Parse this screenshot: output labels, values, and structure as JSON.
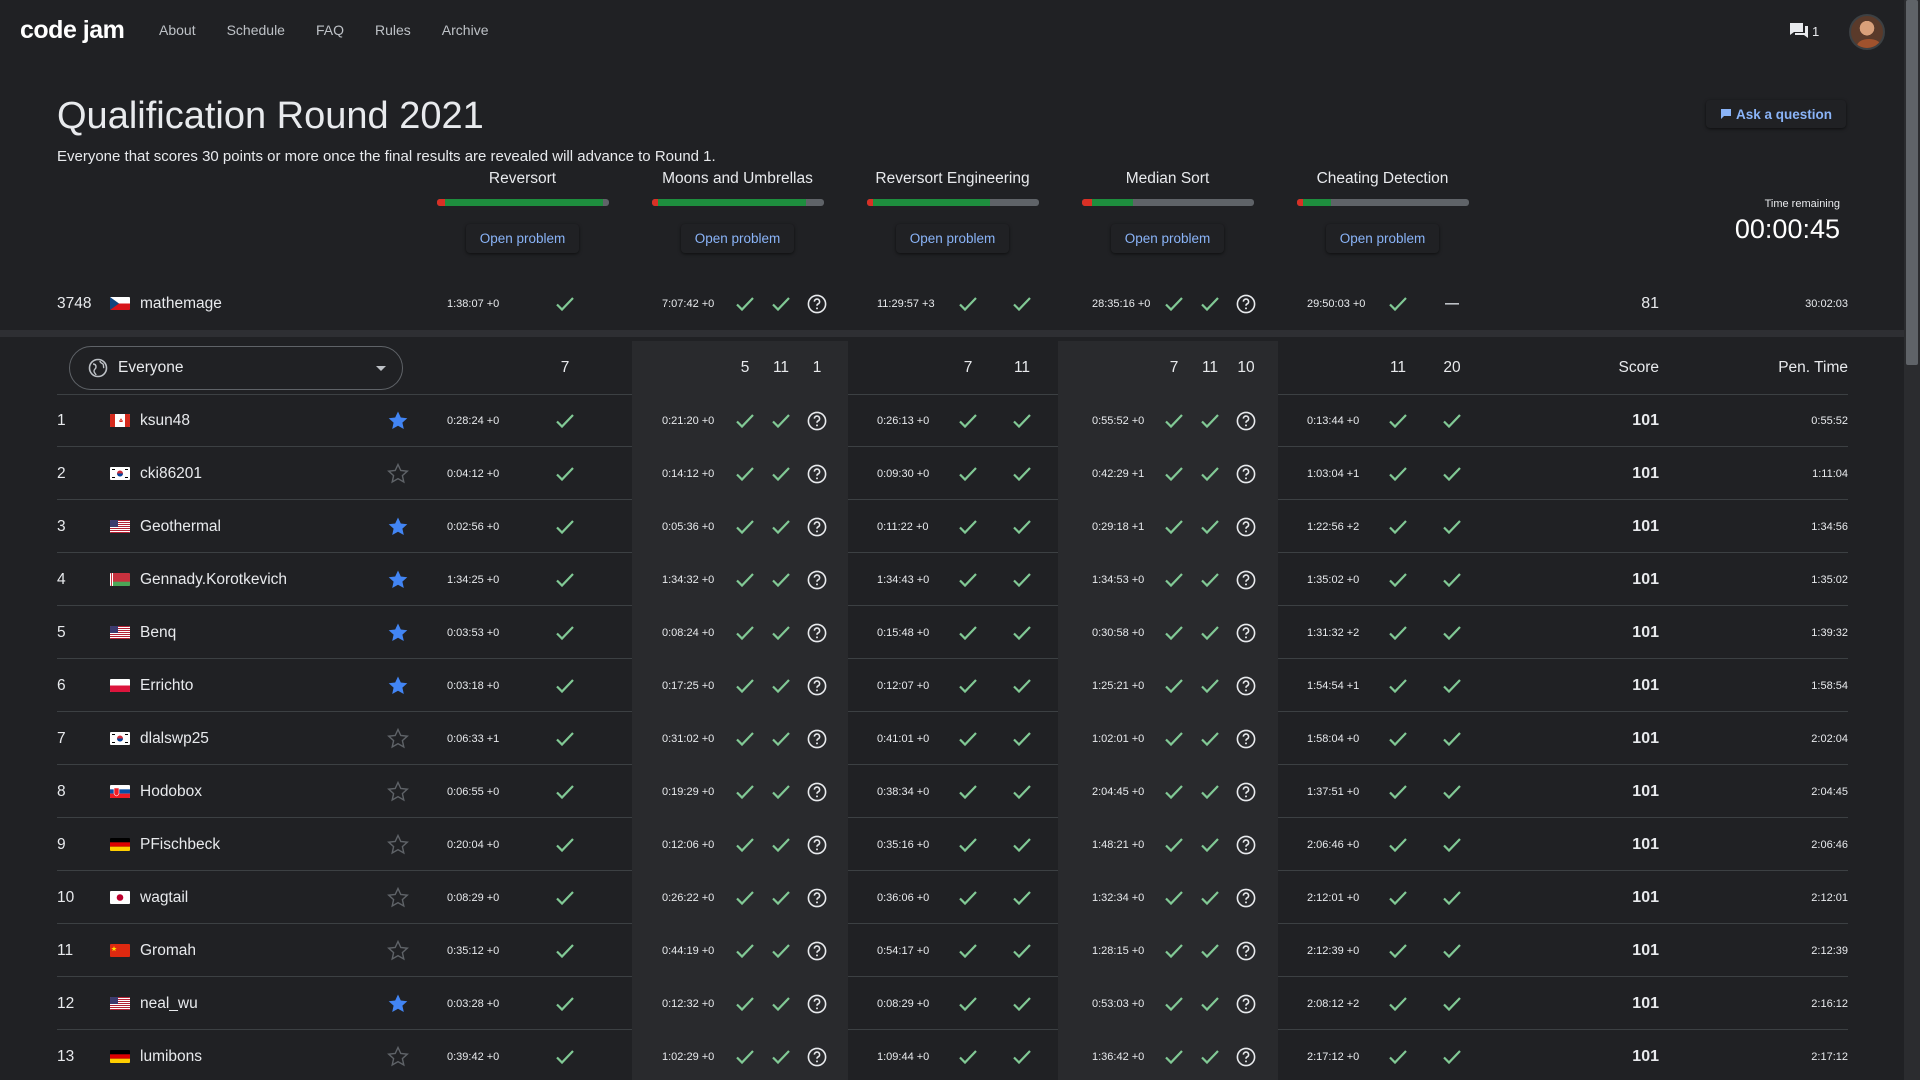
{
  "app": {
    "logo": "code jam"
  },
  "nav": [
    "About",
    "Schedule",
    "FAQ",
    "Rules",
    "Archive"
  ],
  "notifications": {
    "count": "1"
  },
  "page": {
    "title": "Qualification Round 2021",
    "subtitle": "Everyone that scores 30 points or more once the final results are revealed will advance to Round 1.",
    "ask_label": "Ask a question",
    "time_label": "Time remaining",
    "time_value": "00:00:45"
  },
  "problems": [
    {
      "name": "Reversort",
      "open_label": "Open problem",
      "bar_red": 0.05,
      "bar_green": 0.92
    },
    {
      "name": "Moons and Umbrellas",
      "open_label": "Open problem",
      "bar_red": 0.04,
      "bar_green": 0.86
    },
    {
      "name": "Reversort Engineering",
      "open_label": "Open problem",
      "bar_red": 0.04,
      "bar_green": 0.68
    },
    {
      "name": "Median Sort",
      "open_label": "Open problem",
      "bar_red": 0.06,
      "bar_green": 0.24
    },
    {
      "name": "Cheating Detection",
      "open_label": "Open problem",
      "bar_red": 0.04,
      "bar_green": 0.16
    }
  ],
  "me": {
    "rank": "3748",
    "flag": "cz",
    "name": "mathemage",
    "times": [
      "1:38:07 +0",
      "7:07:42 +0",
      "11:29:57 +3",
      "28:35:16 +0",
      "29:50:03 +0"
    ],
    "p5_last": "dash",
    "score": "81",
    "penalty": "30:02:03"
  },
  "filter": {
    "label": "Everyone"
  },
  "header": {
    "p1": [
      "7"
    ],
    "p2": [
      "5",
      "11",
      "1"
    ],
    "p3": [
      "7",
      "11"
    ],
    "p4": [
      "7",
      "11",
      "10"
    ],
    "p5": [
      "11",
      "20"
    ],
    "score_label": "Score",
    "penalty_label": "Pen. Time"
  },
  "rows": [
    {
      "rank": "1",
      "flag": "ca",
      "name": "ksun48",
      "starred": true,
      "times": [
        "0:28:24 +0",
        "0:21:20 +0",
        "0:26:13 +0",
        "0:55:52 +0",
        "0:13:44 +0"
      ],
      "score": "101",
      "penalty": "0:55:52"
    },
    {
      "rank": "2",
      "flag": "kr",
      "name": "cki86201",
      "starred": false,
      "times": [
        "0:04:12 +0",
        "0:14:12 +0",
        "0:09:30 +0",
        "0:42:29 +1",
        "1:03:04 +1"
      ],
      "score": "101",
      "penalty": "1:11:04"
    },
    {
      "rank": "3",
      "flag": "us",
      "name": "Geothermal",
      "starred": true,
      "times": [
        "0:02:56 +0",
        "0:05:36 +0",
        "0:11:22 +0",
        "0:29:18 +1",
        "1:22:56 +2"
      ],
      "score": "101",
      "penalty": "1:34:56"
    },
    {
      "rank": "4",
      "flag": "by",
      "name": "Gennady.Korotkevich",
      "starred": true,
      "times": [
        "1:34:25 +0",
        "1:34:32 +0",
        "1:34:43 +0",
        "1:34:53 +0",
        "1:35:02 +0"
      ],
      "score": "101",
      "penalty": "1:35:02"
    },
    {
      "rank": "5",
      "flag": "us",
      "name": "Benq",
      "starred": true,
      "times": [
        "0:03:53 +0",
        "0:08:24 +0",
        "0:15:48 +0",
        "0:30:58 +0",
        "1:31:32 +2"
      ],
      "score": "101",
      "penalty": "1:39:32"
    },
    {
      "rank": "6",
      "flag": "pl",
      "name": "Errichto",
      "starred": true,
      "times": [
        "0:03:18 +0",
        "0:17:25 +0",
        "0:12:07 +0",
        "1:25:21 +0",
        "1:54:54 +1"
      ],
      "score": "101",
      "penalty": "1:58:54"
    },
    {
      "rank": "7",
      "flag": "kr",
      "name": "dlalswp25",
      "starred": false,
      "times": [
        "0:06:33 +1",
        "0:31:02 +0",
        "0:41:01 +0",
        "1:02:01 +0",
        "1:58:04 +0"
      ],
      "score": "101",
      "penalty": "2:02:04"
    },
    {
      "rank": "8",
      "flag": "sk",
      "name": "Hodobox",
      "starred": false,
      "times": [
        "0:06:55 +0",
        "0:19:29 +0",
        "0:38:34 +0",
        "2:04:45 +0",
        "1:37:51 +0"
      ],
      "score": "101",
      "penalty": "2:04:45"
    },
    {
      "rank": "9",
      "flag": "de",
      "name": "PFischbeck",
      "starred": false,
      "times": [
        "0:20:04 +0",
        "0:12:06 +0",
        "0:35:16 +0",
        "1:48:21 +0",
        "2:06:46 +0"
      ],
      "score": "101",
      "penalty": "2:06:46"
    },
    {
      "rank": "10",
      "flag": "jp",
      "name": "wagtail",
      "starred": false,
      "times": [
        "0:08:29 +0",
        "0:26:22 +0",
        "0:36:06 +0",
        "1:32:34 +0",
        "2:12:01 +0"
      ],
      "score": "101",
      "penalty": "2:12:01"
    },
    {
      "rank": "11",
      "flag": "cn",
      "name": "Gromah",
      "starred": false,
      "times": [
        "0:35:12 +0",
        "0:44:19 +0",
        "0:54:17 +0",
        "1:28:15 +0",
        "2:12:39 +0"
      ],
      "score": "101",
      "penalty": "2:12:39"
    },
    {
      "rank": "12",
      "flag": "us",
      "name": "neal_wu",
      "starred": true,
      "times": [
        "0:03:28 +0",
        "0:12:32 +0",
        "0:08:29 +0",
        "0:53:03 +0",
        "2:08:12 +2"
      ],
      "score": "101",
      "penalty": "2:16:12"
    },
    {
      "rank": "13",
      "flag": "de",
      "name": "lumibons",
      "starred": false,
      "times": [
        "0:39:42 +0",
        "1:02:29 +0",
        "1:09:44 +0",
        "1:36:42 +0",
        "2:17:12 +0"
      ],
      "score": "101",
      "penalty": "2:17:12"
    }
  ],
  "colors": {
    "accent": "#8ab4f8",
    "check": "#81c995",
    "star_on": "#4285f4",
    "star_off": "#5f6368",
    "bar_red": "#d93025",
    "bar_green": "#1e8e3e"
  }
}
